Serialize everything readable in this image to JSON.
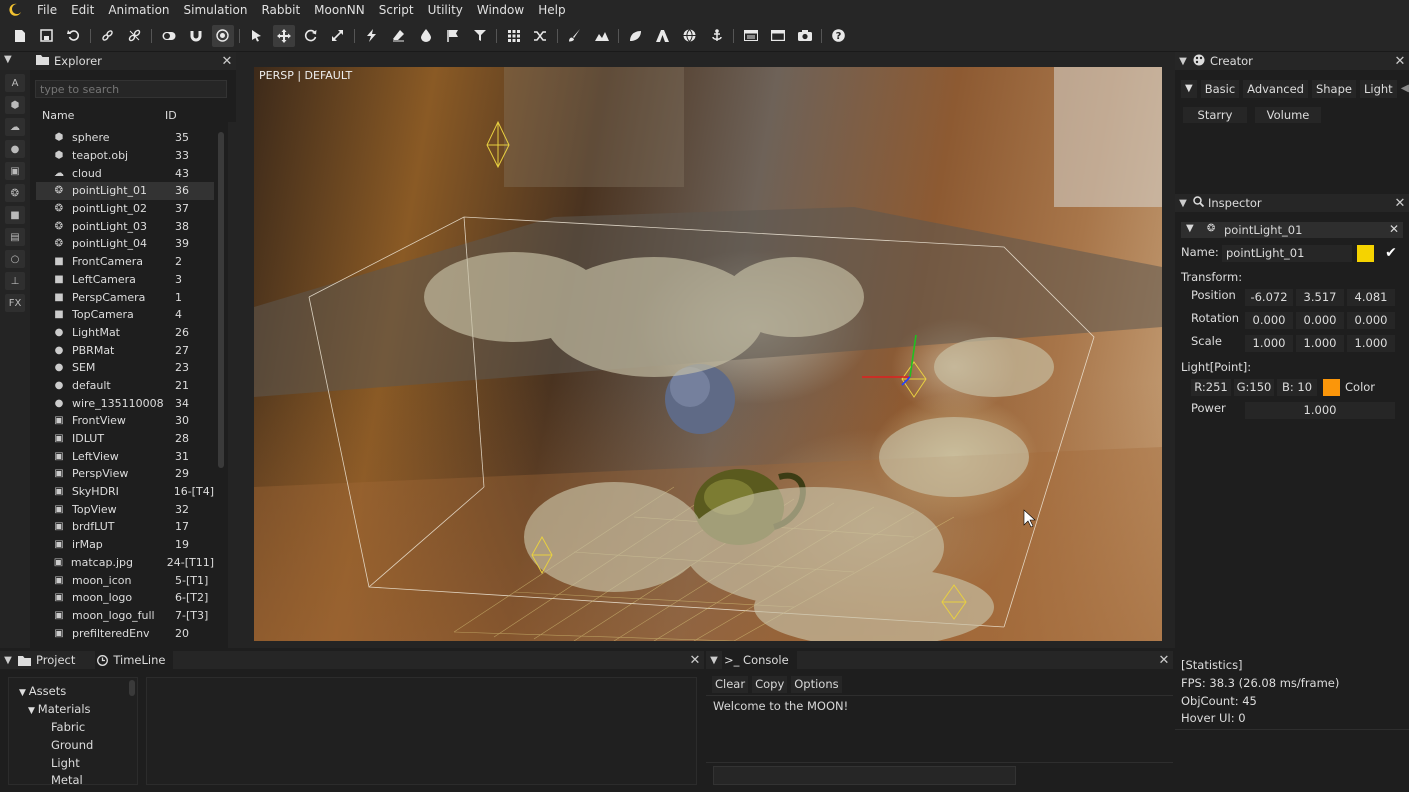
{
  "menu": [
    "File",
    "Edit",
    "Animation",
    "Simulation",
    "Rabbit",
    "MoonNN",
    "Script",
    "Utility",
    "Window",
    "Help"
  ],
  "toolbar_icons": [
    "new-file",
    "save",
    "undo",
    "link",
    "unlink",
    "toggle",
    "magnet",
    "target",
    "select-arrow",
    "move",
    "rotate",
    "scale",
    "lightning",
    "eraser",
    "drop",
    "flag",
    "filter",
    "grid",
    "shuffle",
    "brush",
    "mountain",
    "leaf",
    "arch",
    "sphere-wire",
    "anchor",
    "panel",
    "window",
    "camera",
    "help"
  ],
  "side_strip": [
    "A",
    "cube",
    "cloud",
    "globe",
    "image",
    "bulb",
    "camera",
    "doc",
    "circle",
    "pin",
    "FX"
  ],
  "explorer": {
    "title": "Explorer",
    "search_placeholder": "type to search",
    "col_name": "Name",
    "col_id": "ID",
    "items": [
      {
        "icon": "⬢",
        "name": "sphere",
        "id": "35"
      },
      {
        "icon": "⬢",
        "name": "teapot.obj",
        "id": "33"
      },
      {
        "icon": "☁",
        "name": "cloud",
        "id": "43"
      },
      {
        "icon": "❂",
        "name": "pointLight_01",
        "id": "36"
      },
      {
        "icon": "❂",
        "name": "pointLight_02",
        "id": "37"
      },
      {
        "icon": "❂",
        "name": "pointLight_03",
        "id": "38"
      },
      {
        "icon": "❂",
        "name": "pointLight_04",
        "id": "39"
      },
      {
        "icon": "■",
        "name": "FrontCamera",
        "id": "2"
      },
      {
        "icon": "■",
        "name": "LeftCamera",
        "id": "3"
      },
      {
        "icon": "■",
        "name": "PerspCamera",
        "id": "1"
      },
      {
        "icon": "■",
        "name": "TopCamera",
        "id": "4"
      },
      {
        "icon": "●",
        "name": "LightMat",
        "id": "26"
      },
      {
        "icon": "●",
        "name": "PBRMat",
        "id": "27"
      },
      {
        "icon": "●",
        "name": "SEM",
        "id": "23"
      },
      {
        "icon": "●",
        "name": "default",
        "id": "21"
      },
      {
        "icon": "●",
        "name": "wire_135110008",
        "id": "34"
      },
      {
        "icon": "▣",
        "name": "FrontView",
        "id": "30"
      },
      {
        "icon": "▣",
        "name": "IDLUT",
        "id": "28"
      },
      {
        "icon": "▣",
        "name": "LeftView",
        "id": "31"
      },
      {
        "icon": "▣",
        "name": "PerspView",
        "id": "29"
      },
      {
        "icon": "▣",
        "name": "SkyHDRI",
        "id": "16-[T4]"
      },
      {
        "icon": "▣",
        "name": "TopView",
        "id": "32"
      },
      {
        "icon": "▣",
        "name": "brdfLUT",
        "id": "17"
      },
      {
        "icon": "▣",
        "name": "irMap",
        "id": "19"
      },
      {
        "icon": "▣",
        "name": "matcap.jpg",
        "id": "24-[T11]"
      },
      {
        "icon": "▣",
        "name": "moon_icon",
        "id": "5-[T1]"
      },
      {
        "icon": "▣",
        "name": "moon_logo",
        "id": "6-[T2]"
      },
      {
        "icon": "▣",
        "name": "moon_logo_full",
        "id": "7-[T3]"
      },
      {
        "icon": "▣",
        "name": "prefilteredEnv",
        "id": "20"
      }
    ],
    "selected_index": 3
  },
  "viewport": {
    "label": "PERSP | DEFAULT"
  },
  "creator": {
    "title": "Creator",
    "tabs": [
      "Basic",
      "Advanced",
      "Shape",
      "Light"
    ],
    "buttons": [
      "Starry",
      "Volume"
    ]
  },
  "inspector": {
    "title": "Inspector",
    "object_name": "pointLight_01",
    "name_label": "Name:",
    "name_value": "pointLight_01",
    "name_color": "#f5d300",
    "transform_label": "Transform:",
    "position_label": "Position",
    "position": [
      "-6.072",
      "3.517",
      "4.081"
    ],
    "rotation_label": "Rotation",
    "rotation": [
      "0.000",
      "0.000",
      "0.000"
    ],
    "scale_label": "Scale",
    "scale": [
      "1.000",
      "1.000",
      "1.000"
    ],
    "light_label": "Light[Point]:",
    "r": "R:251",
    "g": "G:150",
    "b": "B: 10",
    "color_label": "Color",
    "light_color": "#fb960a",
    "power_label": "Power",
    "power": "1.000"
  },
  "project": {
    "tab_project": "Project",
    "tab_timeline": "TimeLine",
    "tree": {
      "assets": "Assets",
      "materials": "Materials",
      "children": [
        "Fabric",
        "Ground",
        "Light",
        "Metal"
      ]
    }
  },
  "console": {
    "title": ">_ Console",
    "buttons": [
      "Clear",
      "Copy",
      "Options"
    ],
    "message": "Welcome to the MOON!"
  },
  "stats": {
    "title": "[Statistics]",
    "fps": "FPS: 38.3 (26.08 ms/frame)",
    "objcount": "ObjCount: 45",
    "hover": "Hover UI: 0"
  }
}
